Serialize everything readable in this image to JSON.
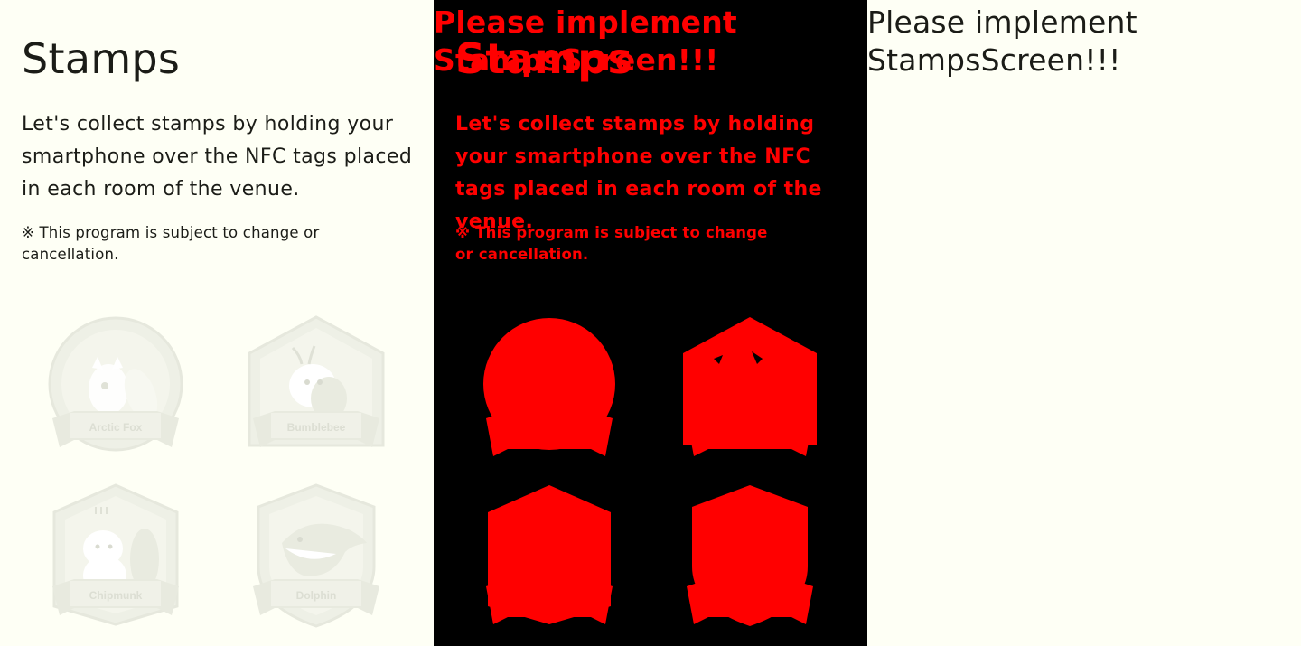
{
  "screen": {
    "title": "Stamps",
    "description": "Let's collect stamps by holding your smartphone over the NFC tags placed in each room of the venue.",
    "note": "※ This program is subject to change or cancellation."
  },
  "stamps": [
    {
      "label": "Arctic Fox",
      "icon": "arctic-fox-stamp-icon"
    },
    {
      "label": "Bumblebee",
      "icon": "bumblebee-stamp-icon"
    },
    {
      "label": "Chipmunk",
      "icon": "chipmunk-stamp-icon"
    },
    {
      "label": "Dolphin",
      "icon": "dolphin-stamp-icon"
    }
  ],
  "placeholder": {
    "message": "Please implement StampsScreen!!!"
  },
  "colors": {
    "background": "#FEFFF5",
    "text": "#1b1c17",
    "diff_background": "#000000",
    "diff_highlight": "#ff0000",
    "stamp_faded": "#eef0e6"
  }
}
